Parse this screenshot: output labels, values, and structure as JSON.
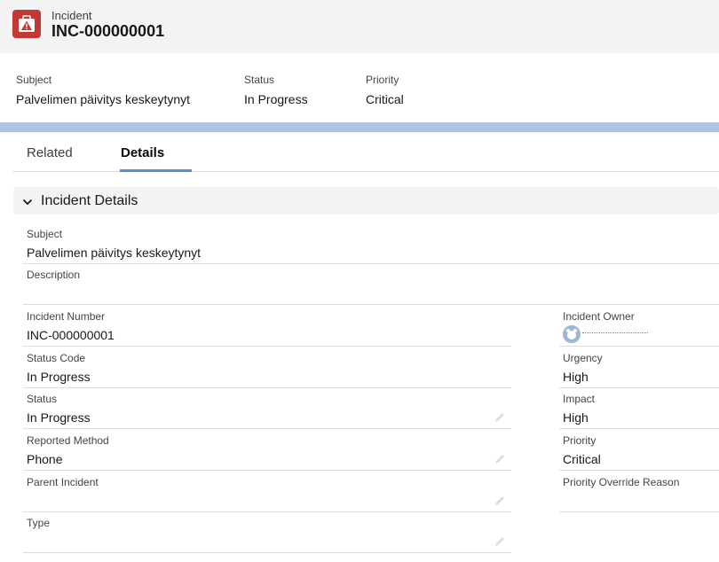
{
  "header": {
    "object_type": "Incident",
    "record_name": "INC-000000001",
    "icon": "warning-triangle-icon",
    "icon_bg": "#c23934"
  },
  "highlights": [
    {
      "label": "Subject",
      "value": "Palvelimen päivitys keskeytynyt"
    },
    {
      "label": "Status",
      "value": "In Progress"
    },
    {
      "label": "Priority",
      "value": "Critical"
    }
  ],
  "tabs": [
    {
      "label": "Related",
      "active": false
    },
    {
      "label": "Details",
      "active": true
    }
  ],
  "section": {
    "title": "Incident Details",
    "icon": "chevron-down-icon"
  },
  "fields": {
    "subject": {
      "label": "Subject",
      "value": "Palvelimen päivitys keskeytynyt"
    },
    "description": {
      "label": "Description",
      "value": ""
    },
    "incident_number": {
      "label": "Incident Number",
      "value": "INC-000000001"
    },
    "status_code": {
      "label": "Status Code",
      "value": "In Progress"
    },
    "status": {
      "label": "Status",
      "value": "In Progress"
    },
    "reported_method": {
      "label": "Reported Method",
      "value": "Phone"
    },
    "parent_incident": {
      "label": "Parent Incident",
      "value": ""
    },
    "type": {
      "label": "Type",
      "value": ""
    },
    "incident_owner": {
      "label": "Incident Owner",
      "value": ""
    },
    "urgency": {
      "label": "Urgency",
      "value": "High"
    },
    "impact": {
      "label": "Impact",
      "value": "High"
    },
    "priority": {
      "label": "Priority",
      "value": "Critical"
    },
    "priority_override_reason": {
      "label": "Priority Override Reason",
      "value": ""
    }
  },
  "colors": {
    "accent_tab": "#5a8fd6",
    "band": "#b0c4df"
  }
}
